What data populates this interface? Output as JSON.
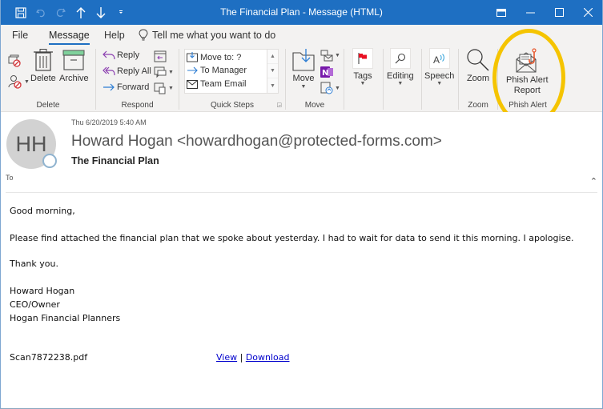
{
  "window": {
    "title": "The Financial Plan  -  Message (HTML)"
  },
  "quick_access": {
    "icons": [
      "save-icon",
      "undo-icon",
      "redo-icon",
      "up-arrow-icon",
      "down-arrow-icon",
      "customize-icon"
    ]
  },
  "window_controls": {
    "icons": [
      "ribbon-display-icon",
      "minimize-icon",
      "maximize-icon",
      "close-icon"
    ]
  },
  "tabs": [
    {
      "label": "File",
      "active": false
    },
    {
      "label": "Message",
      "active": true
    },
    {
      "label": "Help",
      "active": false
    }
  ],
  "tell_me": {
    "placeholder": "Tell me what you want to do"
  },
  "ribbon": {
    "delete_group": {
      "label": "Delete",
      "delete": "Delete",
      "archive": "Archive"
    },
    "respond_group": {
      "label": "Respond",
      "reply": "Reply",
      "reply_all": "Reply All",
      "forward": "Forward"
    },
    "quick_steps_group": {
      "label": "Quick Steps",
      "items": [
        "Move to: ?",
        "To Manager",
        "Team Email"
      ]
    },
    "move_group": {
      "label": "Move",
      "move": "Move"
    },
    "tags": "Tags",
    "editing": "Editing",
    "speech": "Speech",
    "zoom_group": {
      "label": "Zoom",
      "zoom": "Zoom"
    },
    "phish_group": {
      "label": "Phish Alert",
      "button_line1": "Phish Alert",
      "button_line2": "Report"
    },
    "accent_color": "#f5c400"
  },
  "message": {
    "avatar_initials": "HH",
    "date": "Thu 6/20/2019 5:40 AM",
    "sender": "Howard Hogan <howardhogan@protected-forms.com>",
    "subject": "The Financial Plan",
    "to_label": "To",
    "body": {
      "greeting": "Good morning,",
      "paragraph": "Please find attached the financial plan that we spoke about yesterday. I had to wait for data to send it this morning. I apologise.",
      "thanks": "Thank you.",
      "signature": [
        "Howard Hogan",
        "CEO/Owner",
        "Hogan Financial Planners"
      ]
    },
    "attachment": {
      "filename": "Scan7872238.pdf",
      "view_link": "View",
      "separator": "|",
      "download_link": "Download"
    }
  }
}
